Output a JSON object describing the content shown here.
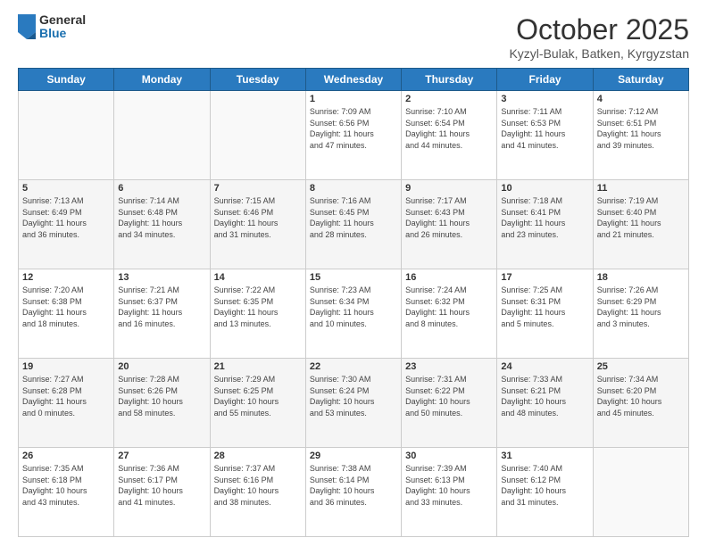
{
  "header": {
    "logo_general": "General",
    "logo_blue": "Blue",
    "title": "October 2025",
    "location": "Kyzyl-Bulak, Batken, Kyrgyzstan"
  },
  "days_of_week": [
    "Sunday",
    "Monday",
    "Tuesday",
    "Wednesday",
    "Thursday",
    "Friday",
    "Saturday"
  ],
  "weeks": [
    [
      {
        "day": "",
        "info": ""
      },
      {
        "day": "",
        "info": ""
      },
      {
        "day": "",
        "info": ""
      },
      {
        "day": "1",
        "info": "Sunrise: 7:09 AM\nSunset: 6:56 PM\nDaylight: 11 hours\nand 47 minutes."
      },
      {
        "day": "2",
        "info": "Sunrise: 7:10 AM\nSunset: 6:54 PM\nDaylight: 11 hours\nand 44 minutes."
      },
      {
        "day": "3",
        "info": "Sunrise: 7:11 AM\nSunset: 6:53 PM\nDaylight: 11 hours\nand 41 minutes."
      },
      {
        "day": "4",
        "info": "Sunrise: 7:12 AM\nSunset: 6:51 PM\nDaylight: 11 hours\nand 39 minutes."
      }
    ],
    [
      {
        "day": "5",
        "info": "Sunrise: 7:13 AM\nSunset: 6:49 PM\nDaylight: 11 hours\nand 36 minutes."
      },
      {
        "day": "6",
        "info": "Sunrise: 7:14 AM\nSunset: 6:48 PM\nDaylight: 11 hours\nand 34 minutes."
      },
      {
        "day": "7",
        "info": "Sunrise: 7:15 AM\nSunset: 6:46 PM\nDaylight: 11 hours\nand 31 minutes."
      },
      {
        "day": "8",
        "info": "Sunrise: 7:16 AM\nSunset: 6:45 PM\nDaylight: 11 hours\nand 28 minutes."
      },
      {
        "day": "9",
        "info": "Sunrise: 7:17 AM\nSunset: 6:43 PM\nDaylight: 11 hours\nand 26 minutes."
      },
      {
        "day": "10",
        "info": "Sunrise: 7:18 AM\nSunset: 6:41 PM\nDaylight: 11 hours\nand 23 minutes."
      },
      {
        "day": "11",
        "info": "Sunrise: 7:19 AM\nSunset: 6:40 PM\nDaylight: 11 hours\nand 21 minutes."
      }
    ],
    [
      {
        "day": "12",
        "info": "Sunrise: 7:20 AM\nSunset: 6:38 PM\nDaylight: 11 hours\nand 18 minutes."
      },
      {
        "day": "13",
        "info": "Sunrise: 7:21 AM\nSunset: 6:37 PM\nDaylight: 11 hours\nand 16 minutes."
      },
      {
        "day": "14",
        "info": "Sunrise: 7:22 AM\nSunset: 6:35 PM\nDaylight: 11 hours\nand 13 minutes."
      },
      {
        "day": "15",
        "info": "Sunrise: 7:23 AM\nSunset: 6:34 PM\nDaylight: 11 hours\nand 10 minutes."
      },
      {
        "day": "16",
        "info": "Sunrise: 7:24 AM\nSunset: 6:32 PM\nDaylight: 11 hours\nand 8 minutes."
      },
      {
        "day": "17",
        "info": "Sunrise: 7:25 AM\nSunset: 6:31 PM\nDaylight: 11 hours\nand 5 minutes."
      },
      {
        "day": "18",
        "info": "Sunrise: 7:26 AM\nSunset: 6:29 PM\nDaylight: 11 hours\nand 3 minutes."
      }
    ],
    [
      {
        "day": "19",
        "info": "Sunrise: 7:27 AM\nSunset: 6:28 PM\nDaylight: 11 hours\nand 0 minutes."
      },
      {
        "day": "20",
        "info": "Sunrise: 7:28 AM\nSunset: 6:26 PM\nDaylight: 10 hours\nand 58 minutes."
      },
      {
        "day": "21",
        "info": "Sunrise: 7:29 AM\nSunset: 6:25 PM\nDaylight: 10 hours\nand 55 minutes."
      },
      {
        "day": "22",
        "info": "Sunrise: 7:30 AM\nSunset: 6:24 PM\nDaylight: 10 hours\nand 53 minutes."
      },
      {
        "day": "23",
        "info": "Sunrise: 7:31 AM\nSunset: 6:22 PM\nDaylight: 10 hours\nand 50 minutes."
      },
      {
        "day": "24",
        "info": "Sunrise: 7:33 AM\nSunset: 6:21 PM\nDaylight: 10 hours\nand 48 minutes."
      },
      {
        "day": "25",
        "info": "Sunrise: 7:34 AM\nSunset: 6:20 PM\nDaylight: 10 hours\nand 45 minutes."
      }
    ],
    [
      {
        "day": "26",
        "info": "Sunrise: 7:35 AM\nSunset: 6:18 PM\nDaylight: 10 hours\nand 43 minutes."
      },
      {
        "day": "27",
        "info": "Sunrise: 7:36 AM\nSunset: 6:17 PM\nDaylight: 10 hours\nand 41 minutes."
      },
      {
        "day": "28",
        "info": "Sunrise: 7:37 AM\nSunset: 6:16 PM\nDaylight: 10 hours\nand 38 minutes."
      },
      {
        "day": "29",
        "info": "Sunrise: 7:38 AM\nSunset: 6:14 PM\nDaylight: 10 hours\nand 36 minutes."
      },
      {
        "day": "30",
        "info": "Sunrise: 7:39 AM\nSunset: 6:13 PM\nDaylight: 10 hours\nand 33 minutes."
      },
      {
        "day": "31",
        "info": "Sunrise: 7:40 AM\nSunset: 6:12 PM\nDaylight: 10 hours\nand 31 minutes."
      },
      {
        "day": "",
        "info": ""
      }
    ]
  ]
}
